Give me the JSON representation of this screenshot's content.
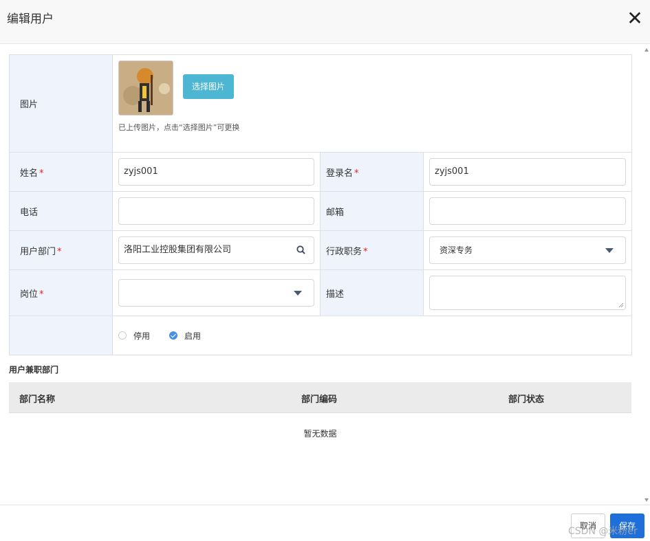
{
  "dialog": {
    "title": "编辑用户"
  },
  "photo": {
    "label": "图片",
    "select_button": "选择图片",
    "hint": "已上传图片，点击“选择图片”可更换"
  },
  "fields": {
    "name": {
      "label": "姓名",
      "value": "zyjs001",
      "required": true
    },
    "login": {
      "label": "登录名",
      "value": "zyjs001",
      "required": true
    },
    "phone": {
      "label": "电话",
      "value": ""
    },
    "email": {
      "label": "邮箱",
      "value": ""
    },
    "department": {
      "label": "用户部门",
      "value": "洛阳工业控股集团有限公司",
      "required": true
    },
    "admin_role": {
      "label": "行政职务",
      "value": "资深专务",
      "required": true
    },
    "post": {
      "label": "岗位",
      "value": "",
      "required": true
    },
    "description": {
      "label": "描述",
      "value": ""
    }
  },
  "status": {
    "options": [
      {
        "label": "停用",
        "checked": false
      },
      {
        "label": "启用",
        "checked": true
      }
    ]
  },
  "concurrent_departments": {
    "title": "用户兼职部门",
    "columns": [
      "部门名称",
      "部门编码",
      "部门状态"
    ],
    "empty_text": "暂无数据"
  },
  "footer": {
    "cancel": "取消",
    "save": "保存"
  },
  "watermark": "CSDN @米粉er",
  "colors": {
    "label_bg": "#eef3fc",
    "primary": "#1e6fd9",
    "info": "#4cb6d3",
    "required": "#e02020"
  }
}
